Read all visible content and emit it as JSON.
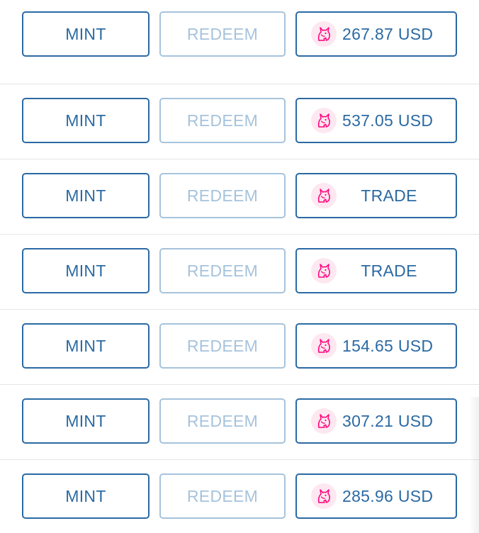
{
  "rows": [
    {
      "mint_label": "MINT",
      "redeem_label": "REDEEM",
      "uni_label": "267.87 USD",
      "uni_kind": "price"
    },
    {
      "mint_label": "MINT",
      "redeem_label": "REDEEM",
      "uni_label": "537.05 USD",
      "uni_kind": "price"
    },
    {
      "mint_label": "MINT",
      "redeem_label": "REDEEM",
      "uni_label": "TRADE",
      "uni_kind": "trade"
    },
    {
      "mint_label": "MINT",
      "redeem_label": "REDEEM",
      "uni_label": "TRADE",
      "uni_kind": "trade"
    },
    {
      "mint_label": "MINT",
      "redeem_label": "REDEEM",
      "uni_label": "154.65 USD",
      "uni_kind": "price"
    },
    {
      "mint_label": "MINT",
      "redeem_label": "REDEEM",
      "uni_label": "307.21 USD",
      "uni_kind": "price"
    },
    {
      "mint_label": "MINT",
      "redeem_label": "REDEEM",
      "uni_label": "285.96 USD",
      "uni_kind": "price"
    }
  ],
  "icons": {
    "uniswap": "uniswap-unicorn-icon"
  },
  "colors": {
    "primary": "#2b6aa3",
    "disabled": "#a6c3dc",
    "divider": "#e3e6ea",
    "uniswap_pink": "#ff007a",
    "uniswap_bg": "#fde7f0"
  }
}
